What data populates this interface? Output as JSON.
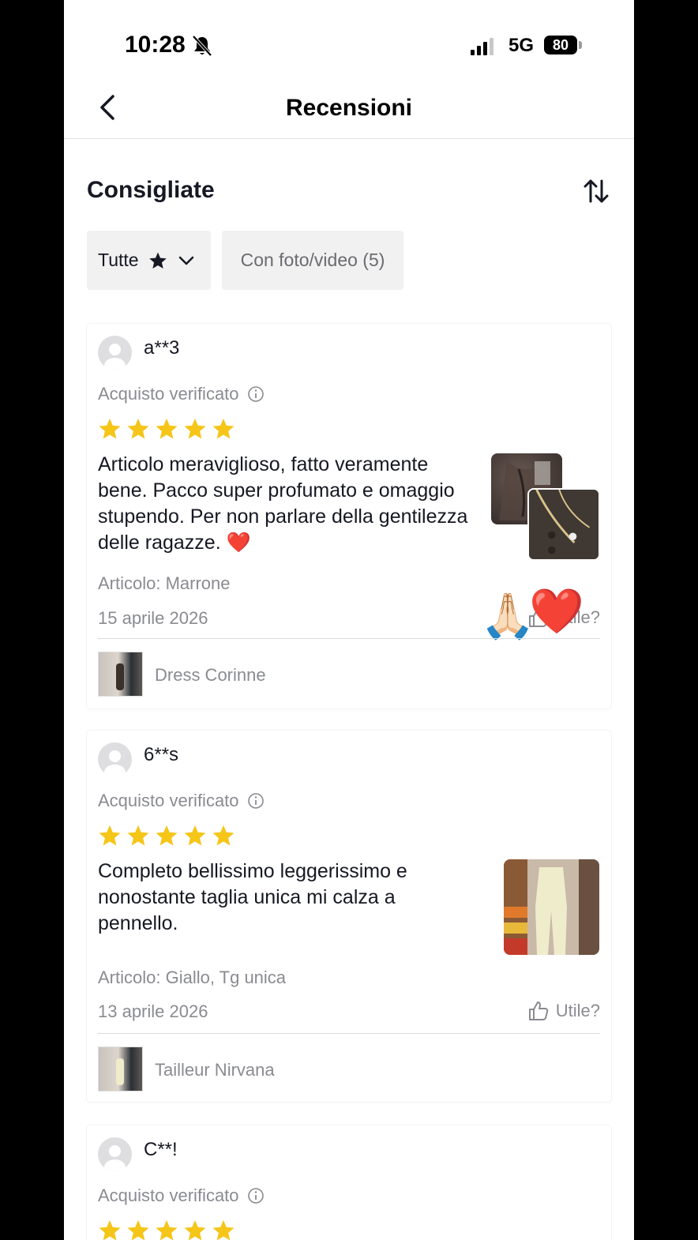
{
  "status_bar": {
    "time": "10:28",
    "network": "5G",
    "battery": "80"
  },
  "nav": {
    "title": "Recensioni"
  },
  "section": {
    "title": "Consigliate"
  },
  "filters": {
    "all_label": "Tutte",
    "media_label": "Con foto/video (5)"
  },
  "colors": {
    "star": "#F5C518",
    "chip_bg": "#F1F1F2",
    "muted_text": "#8A8B91"
  },
  "reviews": [
    {
      "user": "a**3",
      "verified_label": "Acquisto verificato",
      "rating": 5,
      "text": "Articolo meraviglioso, fatto veramente bene. Pacco super profumato e omaggio stupendo. Per non parlare della gentilezza delle ragazze. ❤️",
      "variant": "Articolo: Marrone",
      "date": "15 aprile 2026",
      "helpful_label": "Utile?",
      "product_name": "Dress Corinne",
      "overlay_emojis": [
        "🙏🏻",
        "❤️"
      ]
    },
    {
      "user": "6**s",
      "verified_label": "Acquisto verificato",
      "rating": 5,
      "text": "Completo bellissimo leggerissimo e nonostante taglia unica mi calza a pennello.",
      "variant": "Articolo: Giallo, Tg unica",
      "date": "13 aprile 2026",
      "helpful_label": "Utile?",
      "product_name": "Tailleur Nirvana"
    },
    {
      "user": "C**!",
      "verified_label": "Acquisto verificato",
      "rating": 5
    }
  ]
}
